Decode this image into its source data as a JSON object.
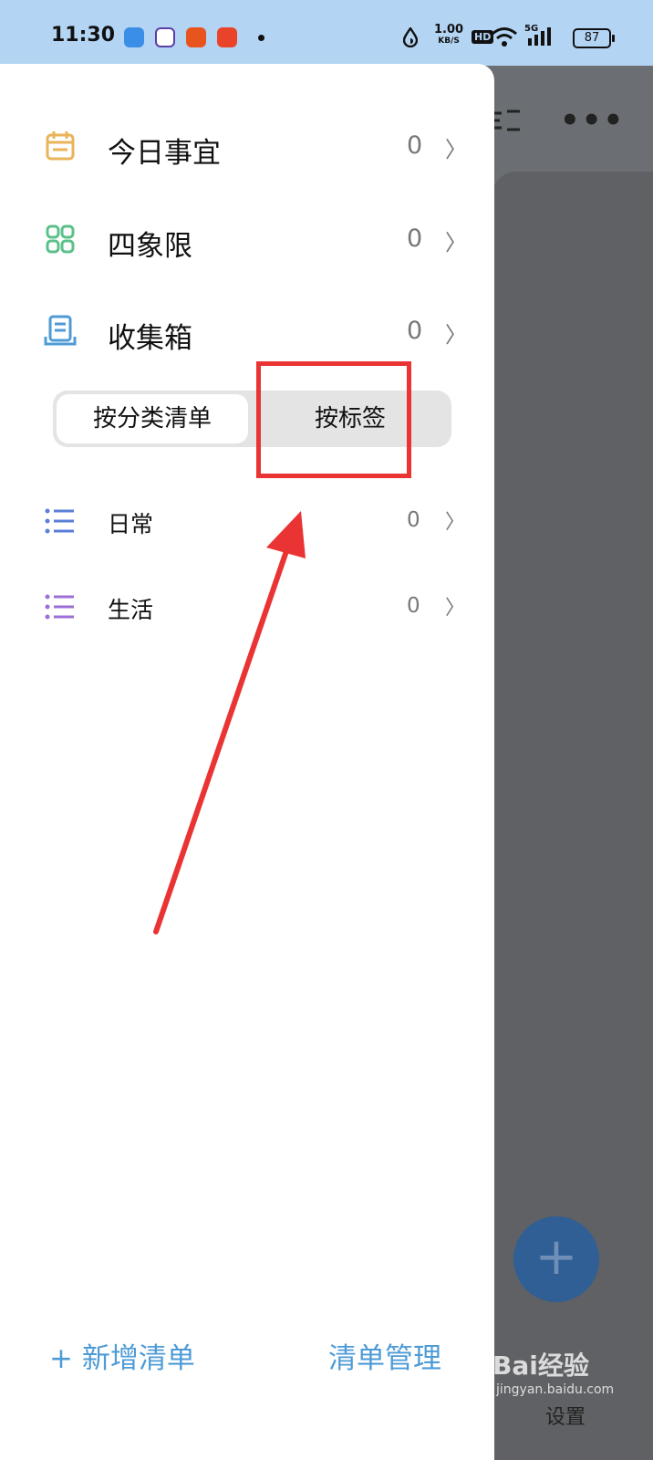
{
  "status_bar": {
    "time": "11:30",
    "net_speed": "1.00",
    "net_unit": "KB/S",
    "hd": "HD",
    "signal": "5G",
    "battery": "87"
  },
  "drawer": {
    "smart_lists": [
      {
        "label": "今日事宜",
        "count": "0",
        "icon": "calendar-icon",
        "color": "#e9b45a"
      },
      {
        "label": "四象限",
        "count": "0",
        "icon": "grid-icon",
        "color": "#5cc08a"
      },
      {
        "label": "收集箱",
        "count": "0",
        "icon": "inbox-icon",
        "color": "#4e9bd6"
      }
    ],
    "segment": {
      "by_category": "按分类清单",
      "by_tag": "按标签",
      "selected": "按分类清单"
    },
    "lists": [
      {
        "label": "日常",
        "count": "0",
        "icon": "list-icon",
        "color": "#5b7fd6"
      },
      {
        "label": "生活",
        "count": "0",
        "icon": "list-icon",
        "color": "#9b6fd6"
      }
    ],
    "footer": {
      "add_list": "+ 新增清单",
      "manage": "清单管理"
    }
  },
  "background": {
    "settings_label": "设置"
  },
  "watermark": {
    "brand": "Bai经验",
    "site": "jingyan.baidu.com"
  },
  "colors": {
    "accent": "#4e9bd6",
    "annotation": "#ea3434"
  }
}
